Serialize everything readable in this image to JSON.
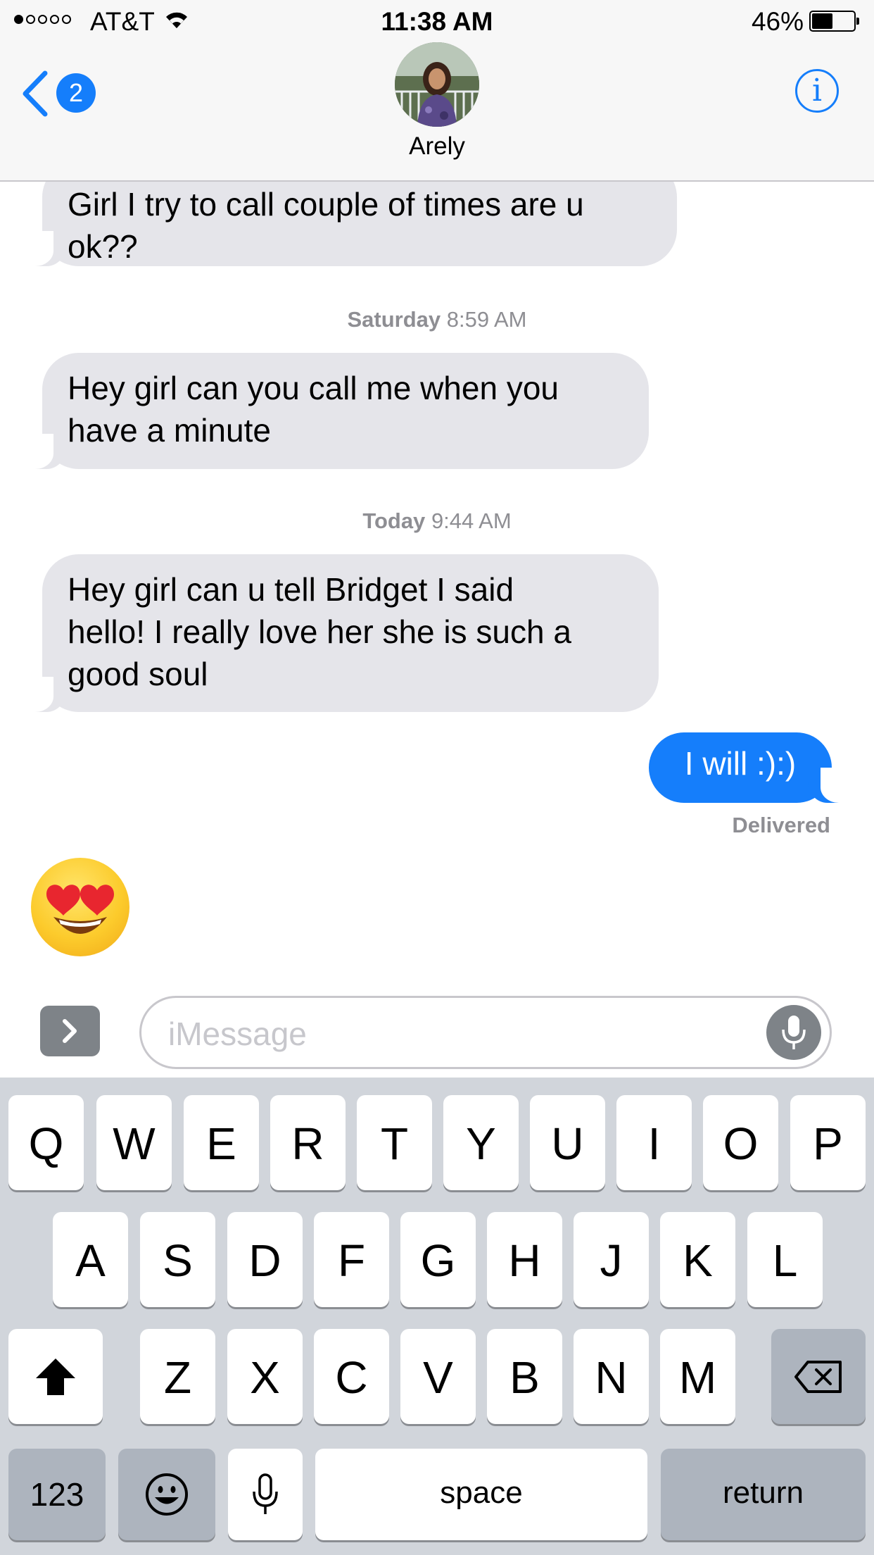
{
  "status_bar": {
    "carrier": "AT&T",
    "time": "11:38 AM",
    "battery_percent": "46%",
    "battery_level": 0.46,
    "signal_bars": 1
  },
  "header": {
    "back_badge": "2",
    "contact_name": "Arely",
    "info_icon": "i"
  },
  "messages": {
    "msg1_line1": "Girl I try to call couple of times are u",
    "msg1_line2": "ok??",
    "timestamp1_day": "Saturday",
    "timestamp1_time": "8:59 AM",
    "msg2_line1": "Hey girl can you call me when you",
    "msg2_line2": "have a minute",
    "timestamp2_day": "Today",
    "timestamp2_time": "9:44 AM",
    "msg3_line1": "Hey girl can u tell Bridget I said",
    "msg3_line2": "hello! I really love her she is such a",
    "msg3_line3": "good soul",
    "sent_msg": "I will :):)",
    "delivered": "Delivered",
    "emoji_msg_icon": "heart-eyes-emoji"
  },
  "composer": {
    "placeholder": "iMessage"
  },
  "keyboard": {
    "row1": [
      "Q",
      "W",
      "E",
      "R",
      "T",
      "Y",
      "U",
      "I",
      "O",
      "P"
    ],
    "row2": [
      "A",
      "S",
      "D",
      "F",
      "G",
      "H",
      "J",
      "K",
      "L"
    ],
    "row3": [
      "Z",
      "X",
      "C",
      "V",
      "B",
      "N",
      "M"
    ],
    "numbers_label": "123",
    "space_label": "space",
    "return_label": "return"
  },
  "colors": {
    "accent": "#157efb",
    "received_bubble": "#e5e5ea",
    "keyboard_bg": "#d1d5db"
  }
}
